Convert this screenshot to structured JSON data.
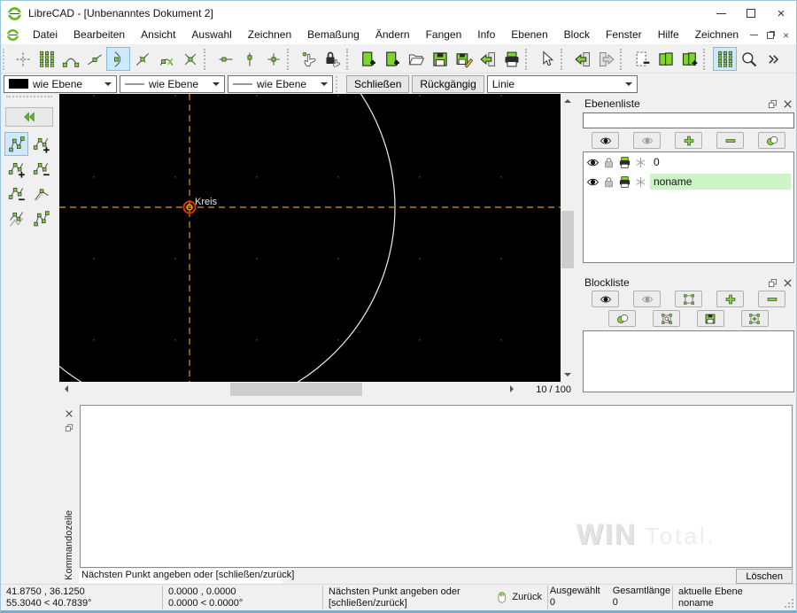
{
  "window": {
    "title": "LibreCAD - [Unbenanntes Dokument 2]"
  },
  "menu": {
    "items": [
      "Datei",
      "Bearbeiten",
      "Ansicht",
      "Auswahl",
      "Zeichnen",
      "Bemaßung",
      "Ändern",
      "Fangen",
      "Info",
      "Ebenen",
      "Block",
      "Fenster",
      "Hilfe",
      "Zeichnen"
    ]
  },
  "toolbar_main": {
    "items": [
      {
        "name": "snap-free-button",
        "icon": "cross"
      },
      {
        "name": "snap-grid-button",
        "icon": "dots"
      },
      {
        "name": "snap-endpoint-button",
        "icon": "arc-ends"
      },
      {
        "name": "snap-entity-button",
        "icon": "line-node"
      },
      {
        "name": "snap-center-button",
        "icon": "arc-center",
        "selected": true
      },
      {
        "name": "snap-middle-button",
        "icon": "line-mid"
      },
      {
        "name": "snap-distance-button",
        "icon": "arc-dist"
      },
      {
        "name": "snap-intersection-button",
        "icon": "x-node"
      },
      {
        "type": "sep"
      },
      {
        "name": "restrict-horizontal-button",
        "icon": "tick-h"
      },
      {
        "name": "restrict-vertical-button",
        "icon": "tick-v"
      },
      {
        "name": "restrict-nothing-button",
        "icon": "tick-cross"
      },
      {
        "type": "sep"
      },
      {
        "name": "set-relative-zero-button",
        "icon": "hand"
      },
      {
        "name": "lock-relative-zero-button",
        "icon": "lock-hand"
      },
      {
        "type": "sep"
      },
      {
        "name": "new-document-button",
        "icon": "doc-plus"
      },
      {
        "name": "new-from-template-button",
        "icon": "doc-plus"
      },
      {
        "name": "open-document-button",
        "icon": "folder"
      },
      {
        "name": "save-document-button",
        "icon": "floppy"
      },
      {
        "name": "save-as-button",
        "icon": "floppy-pen"
      },
      {
        "name": "export-document-button",
        "icon": "door-left"
      },
      {
        "name": "print-button",
        "icon": "printer"
      },
      {
        "type": "sep"
      },
      {
        "name": "selection-pointer-button",
        "icon": "cursor"
      },
      {
        "type": "sep"
      },
      {
        "name": "undo-button",
        "icon": "door-left"
      },
      {
        "name": "redo-button",
        "icon": "door-right"
      },
      {
        "type": "sep"
      },
      {
        "name": "close-document-button",
        "icon": "doc-minus"
      },
      {
        "name": "two-documents-button",
        "icon": "doc-pair"
      },
      {
        "name": "add-document-button",
        "icon": "doc-pair-plus"
      },
      {
        "type": "sep"
      },
      {
        "name": "grid-toggle-button",
        "icon": "dots",
        "selected": true
      },
      {
        "name": "zoom-button",
        "icon": "magnifier"
      },
      {
        "name": "toolbar-overflow-button",
        "icon": "chevrons"
      }
    ]
  },
  "toolbar_pen": {
    "color": "wie Ebene",
    "width": "wie Ebene",
    "linetype": "wie Ebene"
  },
  "toolbar_actions": {
    "close_label": "Schließen",
    "undo_label": "Rückgängig",
    "tool_combo": "Linie"
  },
  "left_tools": {
    "items": [
      {
        "name": "tool-polyline-button",
        "icon": "polyline",
        "selected": true
      },
      {
        "name": "tool-polyline-add-node-button",
        "icon": "polyline-plus"
      },
      {
        "name": "tool-polyline-append-node-button",
        "icon": "polyline-plus"
      },
      {
        "name": "tool-polyline-delete-node-button",
        "icon": "polyline-minus"
      },
      {
        "name": "tool-polyline-delete-between-button",
        "icon": "polyline-minus"
      },
      {
        "name": "tool-polyline-trim-button",
        "icon": "angle"
      },
      {
        "name": "tool-polyline-equidistant-button",
        "icon": "equidist"
      },
      {
        "name": "tool-polyline-segments-button",
        "icon": "polyline"
      }
    ]
  },
  "canvas": {
    "snap_label": "Kreis",
    "page_indicator": "10 / 100"
  },
  "panels": {
    "layers": {
      "title": "Ebenenliste",
      "toolbar": [
        {
          "name": "show-all-layers-button",
          "icon": "eye"
        },
        {
          "name": "hide-all-layers-button",
          "icon": "eye-grey"
        },
        {
          "name": "add-layer-button",
          "icon": "plus"
        },
        {
          "name": "remove-layer-button",
          "icon": "minus"
        },
        {
          "name": "edit-layer-attributes-button",
          "icon": "pen-colors"
        }
      ],
      "rows": [
        {
          "name": "0"
        },
        {
          "name": "noname"
        }
      ]
    },
    "blocks": {
      "title": "Blockliste",
      "toolbar1": [
        {
          "name": "show-all-blocks-button",
          "icon": "eye"
        },
        {
          "name": "hide-all-blocks-button",
          "icon": "eye-grey"
        },
        {
          "name": "toggle-block-visibility-button",
          "icon": "block"
        },
        {
          "name": "add-block-button",
          "icon": "plus"
        },
        {
          "name": "remove-block-button",
          "icon": "minus"
        }
      ],
      "toolbar2": [
        {
          "name": "rename-block-button",
          "icon": "pen-colors"
        },
        {
          "name": "edit-block-button",
          "icon": "block-edit"
        },
        {
          "name": "save-block-button",
          "icon": "floppy"
        },
        {
          "name": "insert-block-button",
          "icon": "block-insert"
        }
      ]
    }
  },
  "command": {
    "dock_title": "Kommandozeile",
    "prompt": "Nächsten Punkt angeben oder [schließen/zurück]",
    "clear_label": "Löschen",
    "watermark_1": "WIN",
    "watermark_2": "Total."
  },
  "statusbar": {
    "abs_coords": "41.8750 , 36.1250",
    "abs_polar": "55.3040 < 40.7839°",
    "rel_coords": "0.0000 , 0.0000",
    "rel_polar": "0.0000 < 0.0000°",
    "hint": "Nächsten Punkt angeben oder [schließen/zurück]",
    "right_click_label": "Zurück",
    "selected_label": "Ausgewählt",
    "selected_value": "0",
    "total_label": "Gesamtlänge",
    "total_value": "0",
    "layer_label": "aktuelle Ebene",
    "layer_value": "noname"
  },
  "colors": {
    "accent_green": "#7dd62c",
    "selection_blue": "#cde8ff",
    "crosshair_orange": "#c08207",
    "layer_highlight": "#ccf4c6",
    "canvas_bg": "#000000",
    "window_border": "#66b0e6"
  },
  "icons": {
    "app-logo-icon": "green-ring",
    "minimize-icon": "dash",
    "maximize-icon": "square",
    "close-icon": "x",
    "float-icon": "two-squares",
    "eye-icon": "eye",
    "padlock-icon": "padlock",
    "printer-icon": "printer",
    "construction-icon": "asterisk",
    "mouse-icon": "mouse-green-buttons",
    "overflow-icon": "chevrons"
  }
}
